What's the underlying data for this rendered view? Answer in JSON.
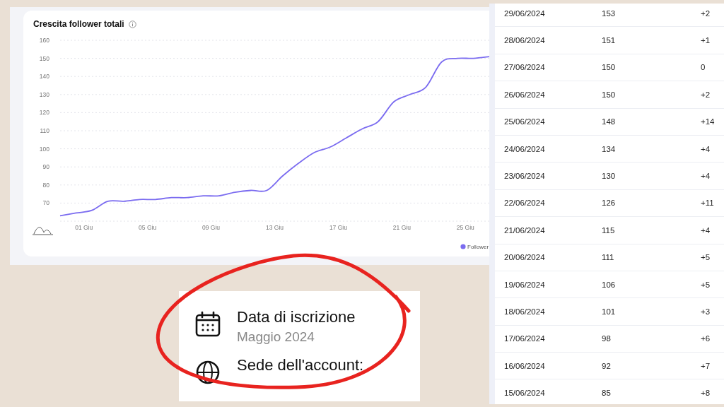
{
  "chart_card": {
    "title": "Crescita follower totali",
    "chart_data": {
      "type": "line",
      "x": [
        -0.5,
        0.5,
        1.5,
        2.5,
        3.5,
        4.5,
        5.5,
        6.5,
        7.5,
        8.5,
        9.5,
        10.5,
        11.5,
        12.5,
        13.5,
        14.5,
        15.5,
        16.5,
        17.5,
        18.5,
        19.5,
        20.5,
        21.5,
        22.5,
        23.5,
        24.5,
        25.5,
        26.5
      ],
      "series": [
        {
          "name": "Follower",
          "color": "#7b6cf0",
          "values": [
            63,
            64.5,
            66,
            71,
            71,
            72,
            72,
            73,
            73,
            74,
            74,
            76,
            77,
            77,
            85,
            92,
            98,
            101,
            106,
            111,
            115,
            126,
            130,
            134,
            148,
            150,
            150,
            151
          ]
        }
      ],
      "grid": true,
      "xlim": [
        -0.5,
        26.5
      ],
      "ylim": [
        60,
        160
      ],
      "xticks": [
        {
          "value": 1,
          "label": "01 Giu"
        },
        {
          "value": 5,
          "label": "05 Giu"
        },
        {
          "value": 9,
          "label": "09 Giu"
        },
        {
          "value": 13,
          "label": "13 Giu"
        },
        {
          "value": 17,
          "label": "17 Giu"
        },
        {
          "value": 21,
          "label": "21 Giu"
        },
        {
          "value": 25,
          "label": "25 Giu"
        }
      ],
      "yticks": [
        70,
        80,
        90,
        100,
        110,
        120,
        130,
        140,
        150,
        160
      ]
    }
  },
  "table": {
    "rows": [
      {
        "date": "29/06/2024",
        "followers": "153",
        "change": "+2"
      },
      {
        "date": "28/06/2024",
        "followers": "151",
        "change": "+1"
      },
      {
        "date": "27/06/2024",
        "followers": "150",
        "change": "0"
      },
      {
        "date": "26/06/2024",
        "followers": "150",
        "change": "+2"
      },
      {
        "date": "25/06/2024",
        "followers": "148",
        "change": "+14"
      },
      {
        "date": "24/06/2024",
        "followers": "134",
        "change": "+4"
      },
      {
        "date": "23/06/2024",
        "followers": "130",
        "change": "+4"
      },
      {
        "date": "22/06/2024",
        "followers": "126",
        "change": "+11"
      },
      {
        "date": "21/06/2024",
        "followers": "115",
        "change": "+4"
      },
      {
        "date": "20/06/2024",
        "followers": "111",
        "change": "+5"
      },
      {
        "date": "19/06/2024",
        "followers": "106",
        "change": "+5"
      },
      {
        "date": "18/06/2024",
        "followers": "101",
        "change": "+3"
      },
      {
        "date": "17/06/2024",
        "followers": "98",
        "change": "+6"
      },
      {
        "date": "16/06/2024",
        "followers": "92",
        "change": "+7"
      },
      {
        "date": "15/06/2024",
        "followers": "85",
        "change": "+8"
      }
    ]
  },
  "profile_card": {
    "items": [
      {
        "kind": "date",
        "label": "Data di iscrizione",
        "value": "Maggio 2024"
      },
      {
        "kind": "location",
        "label": "Sede dell'account:"
      }
    ]
  }
}
